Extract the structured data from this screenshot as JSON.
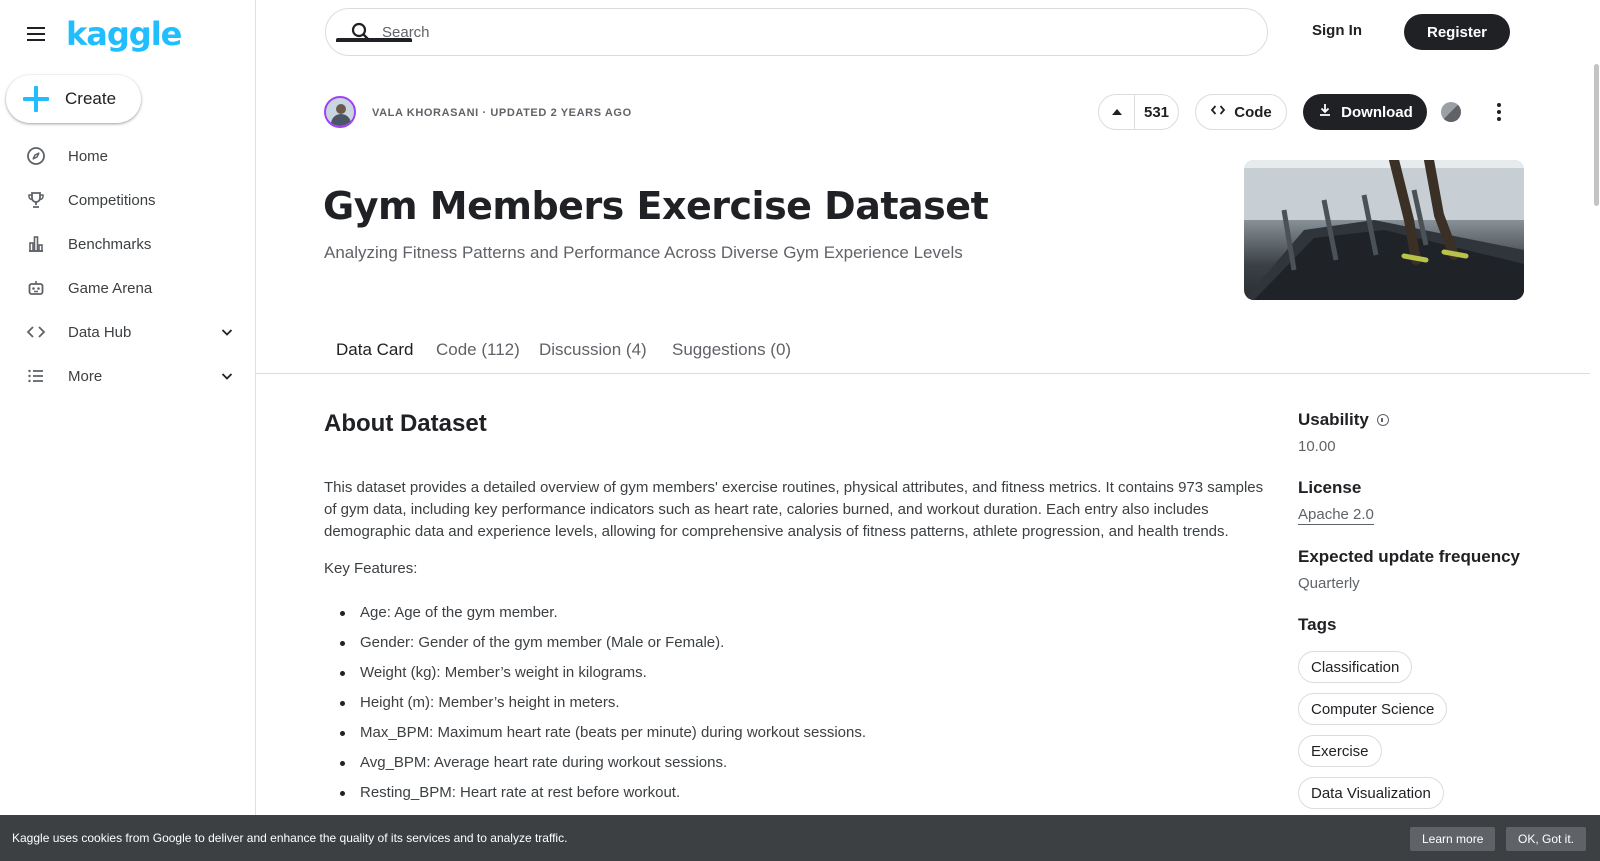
{
  "app": {
    "logo": "kaggle"
  },
  "sidebar": {
    "create_label": "Create",
    "items": [
      {
        "label": "Home",
        "icon": "compass-icon"
      },
      {
        "label": "Competitions",
        "icon": "trophy-icon"
      },
      {
        "label": "Benchmarks",
        "icon": "bar-chart-icon"
      },
      {
        "label": "Game Arena",
        "icon": "robot-icon"
      },
      {
        "label": "Data Hub",
        "icon": "code-icon"
      },
      {
        "label": "More",
        "icon": "list-icon"
      }
    ]
  },
  "header": {
    "search_placeholder": "Search",
    "sign_in": "Sign In",
    "register": "Register"
  },
  "dataset": {
    "owner_line": "VALA KHORASANI · UPDATED 2 YEARS AGO",
    "votes": "531",
    "code_label": "Code",
    "download_label": "Download",
    "title": "Gym Members Exercise Dataset",
    "subtitle": "Analyzing Fitness Patterns and Performance Across Diverse Gym Experience Levels"
  },
  "tabs": [
    {
      "label": "Data Card",
      "active": true
    },
    {
      "label": "Code (112)"
    },
    {
      "label": "Discussion (4)"
    },
    {
      "label": "Suggestions (0)"
    }
  ],
  "content": {
    "heading": "About Dataset",
    "description": "This dataset provides a detailed overview of gym members' exercise routines, physical attributes, and fitness metrics. It contains 973 samples of gym data, including key performance indicators such as heart rate, calories burned, and workout duration. Each entry also includes demographic data and experience levels, allowing for comprehensive analysis of fitness patterns, athlete progression, and health trends.",
    "key_features_label": "Key Features:",
    "features": [
      "Age: Age of the gym member.",
      "Gender: Gender of the gym member (Male or Female).",
      "Weight (kg): Member’s weight in kilograms.",
      "Height (m): Member’s height in meters.",
      "Max_BPM: Maximum heart rate (beats per minute) during workout sessions.",
      "Avg_BPM: Average heart rate during workout sessions.",
      "Resting_BPM: Heart rate at rest before workout."
    ]
  },
  "meta": {
    "usability_label": "Usability",
    "usability_value": "10.00",
    "license_label": "License",
    "license_value": "Apache 2.0",
    "frequency_label": "Expected update frequency",
    "frequency_value": "Quarterly",
    "tags_label": "Tags",
    "tags": [
      "Classification",
      "Computer Science",
      "Exercise",
      "Data Visualization"
    ]
  },
  "cookie": {
    "text": "Kaggle uses cookies from Google to deliver and enhance the quality of its services and to analyze traffic.",
    "learn_more": "Learn more",
    "ok": "OK, Got it."
  },
  "colors": {
    "brand": "#20beff",
    "dark": "#202124",
    "muted": "#5f6368",
    "cookie_bg": "#3c4043"
  }
}
